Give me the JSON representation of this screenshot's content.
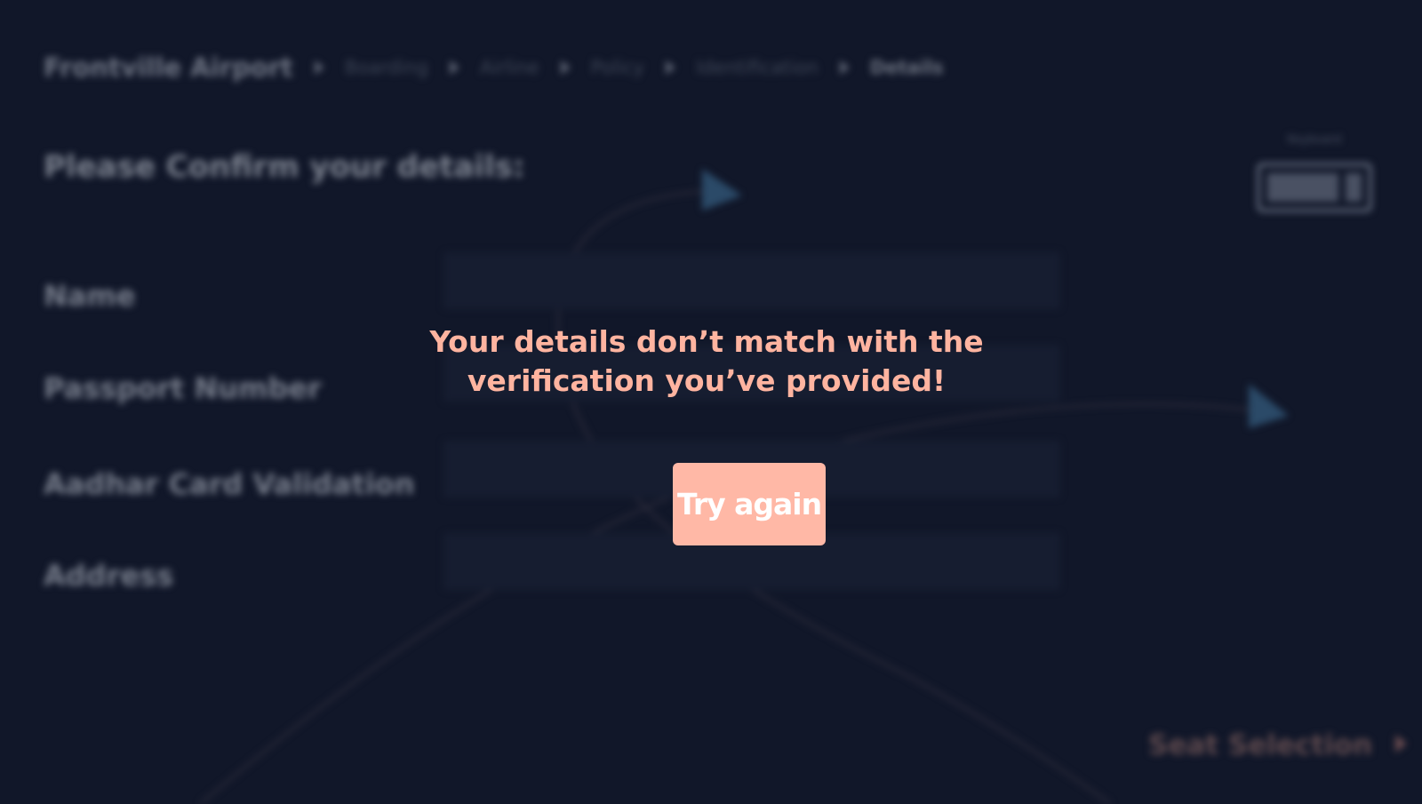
{
  "breadcrumb": {
    "root": "Frontville Airport",
    "steps": [
      "Boarding",
      "Airline",
      "Policy",
      "Identification",
      "Details"
    ],
    "separator_icon": "caret-right-icon"
  },
  "page": {
    "title": "Please Confirm your details:"
  },
  "keyboard": {
    "label": "Keyboard",
    "icon": "keyboard-icon"
  },
  "form": {
    "fields": [
      {
        "label": "Name",
        "value": ""
      },
      {
        "label": "Passport Number",
        "value": ""
      },
      {
        "label": "Aadhar Card Validation",
        "value": ""
      },
      {
        "label": "Address",
        "value": ""
      }
    ]
  },
  "navigation": {
    "next_label": "Seat Selection",
    "next_icon": "caret-right-icon"
  },
  "modal": {
    "message_line1": "Your details don’t match with the",
    "message_line2": "verification you’ve provided!",
    "button_label": "Try again"
  },
  "colors": {
    "background": "#111729",
    "accent": "#ffb8a6",
    "error_text": "#ffb4a0",
    "decor_arrow": "#2b4a68"
  }
}
